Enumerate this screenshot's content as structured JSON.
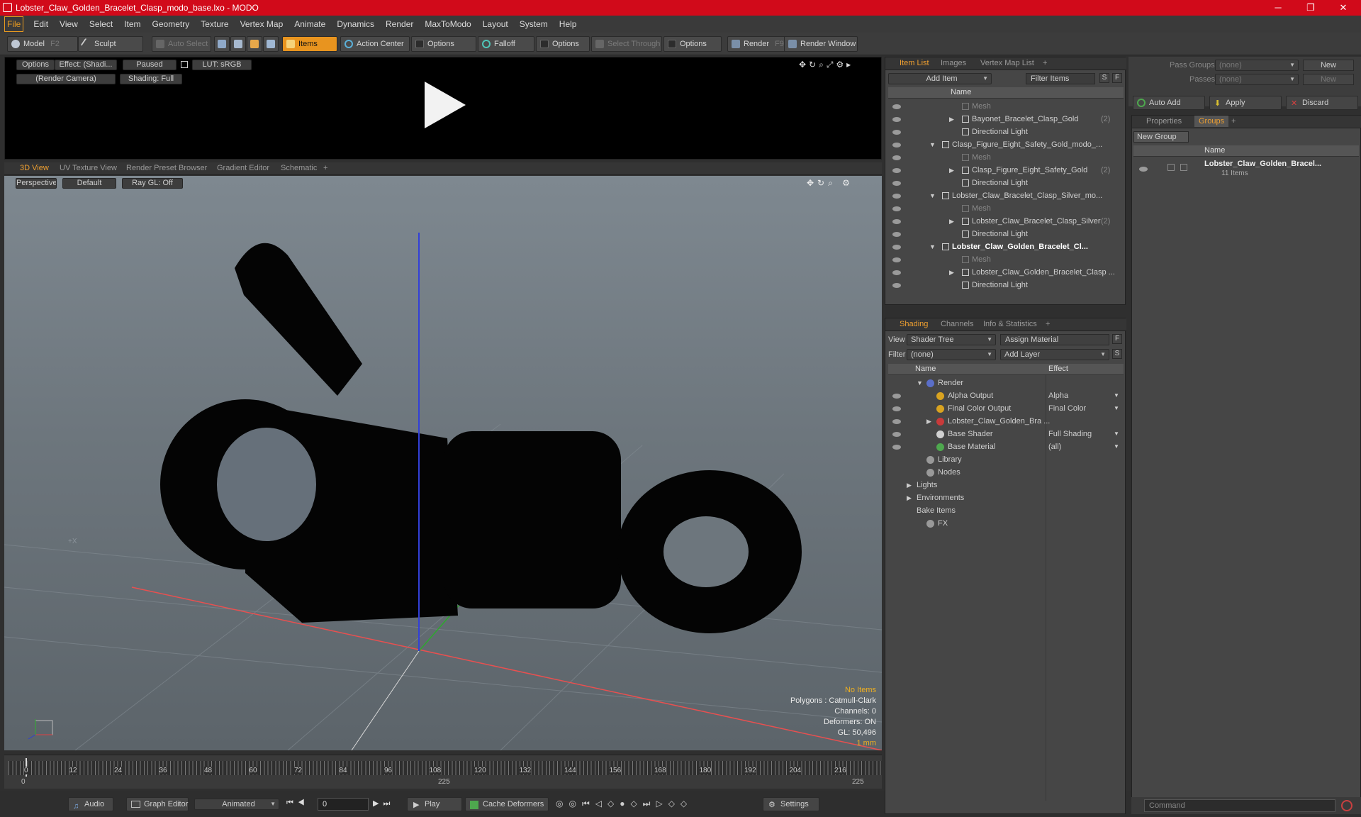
{
  "window": {
    "title": "Lobster_Claw_Golden_Bracelet_Clasp_modo_base.lxo - MODO",
    "minimize": "─",
    "maximize": "❐",
    "close": "✕"
  },
  "menu": [
    "File",
    "Edit",
    "View",
    "Select",
    "Item",
    "Geometry",
    "Texture",
    "Vertex Map",
    "Animate",
    "Dynamics",
    "Render",
    "MaxToModo",
    "Layout",
    "System",
    "Help"
  ],
  "toolbar": {
    "model": "Model",
    "model_key": "F2",
    "sculpt": "Sculpt",
    "auto_select": "Auto Select",
    "items": "Items",
    "action_center": "Action Center",
    "options1": "Options",
    "falloff": "Falloff",
    "options2": "Options",
    "select_through": "Select Through",
    "options3": "Options",
    "render": "Render",
    "render_key": "F9",
    "render_window": "Render Window"
  },
  "preview": {
    "options": "Options",
    "effect": "Effect: (Shadi...",
    "paused": "Paused",
    "lut": "LUT: sRGB",
    "camera": "(Render Camera)",
    "shading": "Shading: Full"
  },
  "viewport": {
    "tabs": [
      "3D View",
      "UV Texture View",
      "Render Preset Browser",
      "Gradient Editor",
      "Schematic",
      "+"
    ],
    "projection": "Perspective",
    "style": "Default",
    "raygl": "Ray GL: Off",
    "stats": {
      "no_items": "No Items",
      "polygons": "Polygons : Catmull-Clark",
      "channels": "Channels: 0",
      "deformers": "Deformers: ON",
      "gl": "GL: 50,496",
      "scale": "1 mm"
    },
    "axis_label": "+X"
  },
  "timeline": {
    "ticks": [
      "0",
      "12",
      "24",
      "36",
      "48",
      "60",
      "72",
      "84",
      "96",
      "108",
      "120",
      "132",
      "144",
      "156",
      "168",
      "180",
      "192",
      "204",
      "216"
    ],
    "range_start": "0",
    "range_mid": "225",
    "range_end": "225"
  },
  "transport": {
    "audio": "Audio",
    "graph_editor": "Graph Editor",
    "animated": "Animated",
    "frame": "0",
    "play": "Play",
    "cache_deformers": "Cache Deformers",
    "settings": "Settings"
  },
  "itemlist": {
    "tabs": [
      "Item List",
      "Images",
      "Vertex Map List",
      "+"
    ],
    "add_item": "Add Item",
    "filter_items": "Filter Items",
    "s": "S",
    "f": "F",
    "name_header": "Name",
    "rows": [
      {
        "label": "Mesh",
        "indent": 3,
        "dim": true,
        "arrow": ""
      },
      {
        "label": "Bayonet_Bracelet_Clasp_Gold",
        "count": "(2)",
        "indent": 3,
        "arrow": "▶"
      },
      {
        "label": "Directional Light",
        "indent": 3,
        "arrow": ""
      },
      {
        "label": "Clasp_Figure_Eight_Safety_Gold_modo_...",
        "indent": 2,
        "arrow": "▼"
      },
      {
        "label": "Mesh",
        "indent": 3,
        "dim": true,
        "arrow": ""
      },
      {
        "label": "Clasp_Figure_Eight_Safety_Gold",
        "count": "(2)",
        "indent": 3,
        "arrow": "▶"
      },
      {
        "label": "Directional Light",
        "indent": 3,
        "arrow": ""
      },
      {
        "label": "Lobster_Claw_Bracelet_Clasp_Silver_mo...",
        "indent": 2,
        "arrow": "▼"
      },
      {
        "label": "Mesh",
        "indent": 3,
        "dim": true,
        "arrow": ""
      },
      {
        "label": "Lobster_Claw_Bracelet_Clasp_Silver",
        "count": "(2)",
        "indent": 3,
        "arrow": "▶"
      },
      {
        "label": "Directional Light",
        "indent": 3,
        "arrow": ""
      },
      {
        "label": "Lobster_Claw_Golden_Bracelet_Cl...",
        "indent": 2,
        "arrow": "▼",
        "bold": true
      },
      {
        "label": "Mesh",
        "indent": 3,
        "dim": true,
        "arrow": ""
      },
      {
        "label": "Lobster_Claw_Golden_Bracelet_Clasp ...",
        "indent": 3,
        "arrow": "▶"
      },
      {
        "label": "Directional Light",
        "indent": 3,
        "arrow": ""
      }
    ]
  },
  "shading": {
    "tabs": [
      "Shading",
      "Channels",
      "Info & Statistics",
      "+"
    ],
    "view_label": "View",
    "view_value": "Shader Tree",
    "assign_material": "Assign Material",
    "filter_label": "Filter",
    "filter_value": "(none)",
    "add_layer": "Add Layer",
    "f": "F",
    "s": "S",
    "name_header": "Name",
    "effect_header": "Effect",
    "rows": [
      {
        "label": "Render",
        "effect": "",
        "indent": 1,
        "arrow": "▼",
        "eye": false,
        "icon": "#5a6ec8"
      },
      {
        "label": "Alpha Output",
        "effect": "Alpha",
        "indent": 2,
        "arrow": "",
        "eye": true,
        "icon": "#d9a320"
      },
      {
        "label": "Final Color Output",
        "effect": "Final Color",
        "indent": 2,
        "arrow": "",
        "eye": true,
        "icon": "#d9a320"
      },
      {
        "label": "Lobster_Claw_Golden_Bra ...",
        "effect": "",
        "indent": 2,
        "arrow": "▶",
        "eye": true,
        "icon": "#c83a3a"
      },
      {
        "label": "Base Shader",
        "effect": "Full Shading",
        "indent": 2,
        "arrow": "",
        "eye": true,
        "icon": "#d0d0d0"
      },
      {
        "label": "Base Material",
        "effect": "(all)",
        "indent": 2,
        "arrow": "",
        "eye": true,
        "icon": "#4ea84e"
      },
      {
        "label": "Library",
        "effect": "",
        "indent": 1,
        "arrow": "",
        "eye": false,
        "icon": "#999999"
      },
      {
        "label": "Nodes",
        "effect": "",
        "indent": 1,
        "arrow": "",
        "eye": false,
        "icon": "#999999"
      },
      {
        "label": "Lights",
        "effect": "",
        "indent": 0,
        "arrow": "▶",
        "eye": false,
        "icon": ""
      },
      {
        "label": "Environments",
        "effect": "",
        "indent": 0,
        "arrow": "▶",
        "eye": false,
        "icon": ""
      },
      {
        "label": "Bake Items",
        "effect": "",
        "indent": 0,
        "arrow": "",
        "eye": false,
        "icon": ""
      },
      {
        "label": "FX",
        "effect": "",
        "indent": 1,
        "arrow": "",
        "eye": false,
        "icon": "#999999"
      }
    ]
  },
  "groups": {
    "pass_groups_label": "Pass Groups",
    "pass_groups_value": "(none)",
    "passes_label": "Passes",
    "passes_value": "(none)",
    "new1": "New",
    "new2": "New",
    "auto_add": "Auto Add",
    "apply": "Apply",
    "discard": "Discard",
    "tabs": [
      "Properties",
      "Groups",
      "+"
    ],
    "new_group": "New Group",
    "name_header": "Name",
    "group_name": "Lobster_Claw_Golden_Bracel...",
    "group_count": "11 Items"
  },
  "command": {
    "placeholder": "Command"
  }
}
